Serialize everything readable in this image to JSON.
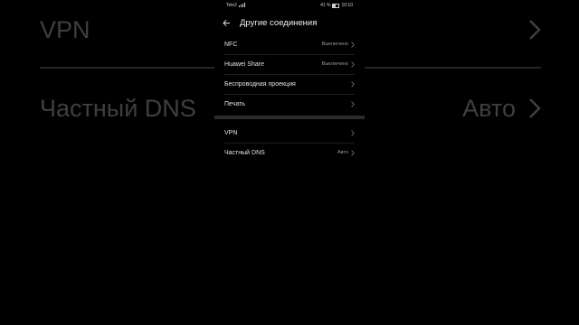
{
  "background": {
    "rows": [
      {
        "label": "VPN",
        "value": ""
      },
      {
        "label": "Частный DNS",
        "value": "Авто"
      }
    ]
  },
  "status_bar": {
    "carrier": "Tele2",
    "battery": "41 %",
    "time": "10:10"
  },
  "header": {
    "title": "Другие соединения"
  },
  "section1": [
    {
      "label": "NFC",
      "value": "Выключено"
    },
    {
      "label": "Huawei Share",
      "value": "Выключено"
    },
    {
      "label": "Беспроводная проекция",
      "value": ""
    },
    {
      "label": "Печать",
      "value": ""
    }
  ],
  "section2": [
    {
      "label": "VPN",
      "value": ""
    },
    {
      "label": "Частный DNS",
      "value": "Авто"
    }
  ],
  "colors": {
    "background": "#000000",
    "text": "#e2e2e2",
    "secondary_text": "#9a9a9a",
    "separator": "#2a2a2a"
  }
}
